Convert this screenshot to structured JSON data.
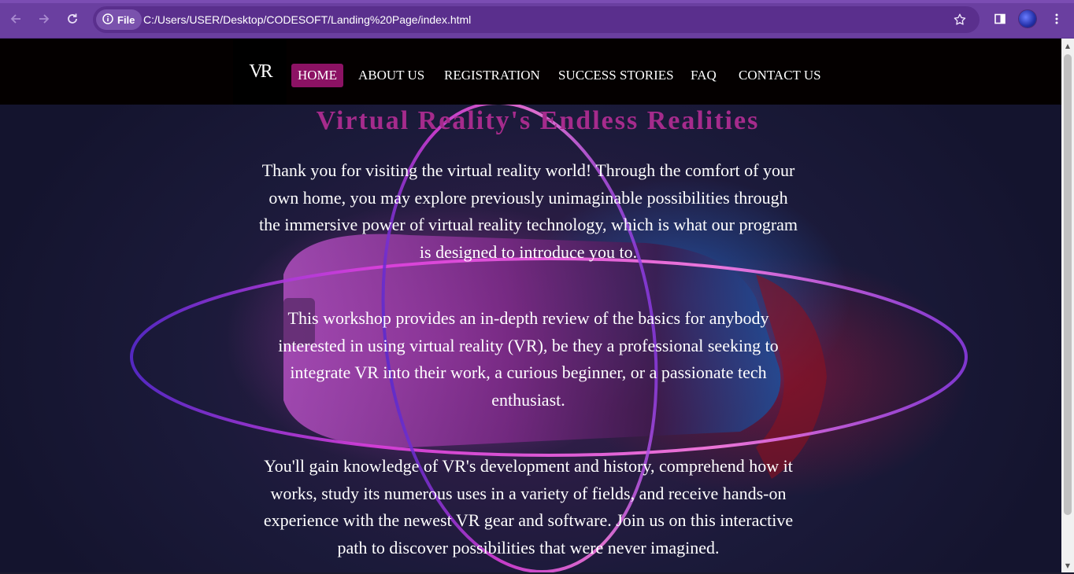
{
  "browser": {
    "site_chip_label": "File",
    "url": "C:/Users/USER/Desktop/CODESOFT/Landing%20Page/index.html",
    "icons": [
      "back-icon",
      "forward-icon",
      "reload-icon",
      "info-icon",
      "star-icon",
      "sidepanel-icon",
      "profile-avatar",
      "menu-icon"
    ]
  },
  "navbar": {
    "logo_text": "VR",
    "items": [
      {
        "label": "HOME",
        "active": true
      },
      {
        "label": "ABOUT US",
        "active": false
      },
      {
        "label": "REGISTRATION",
        "active": false
      },
      {
        "label": "SUCCESS STORIES",
        "active": false
      },
      {
        "label": "FAQ",
        "active": false
      },
      {
        "label": "CONTACT US",
        "active": false
      }
    ]
  },
  "hero": {
    "title": "Virtual Reality's Endless Realities",
    "paragraphs": [
      "Thank you for visiting the virtual reality world! Through the comfort of your own home, you may explore previously unimaginable possibilities through the immersive power of virtual reality technology, which is what our program is designed to introduce you to.",
      "This workshop provides an in-depth review of the basics for anybody interested in using virtual reality (VR), be they a professional seeking to integrate VR into their work, a curious beginner, or a passionate tech enthusiast.",
      "You'll gain knowledge of VR's development and history, comprehend how it works, study its numerous uses in a variety of fields, and receive hands-on experience with the newest VR gear and software. Join us on this interactive path to discover possibilities that were never imagined."
    ]
  },
  "colors": {
    "browser_chrome": "#6a3fa0",
    "navbar_bg": "#040000",
    "nav_active_bg": "#8c1264",
    "title_color": "#a52b8c",
    "text_color": "#ffffff"
  }
}
